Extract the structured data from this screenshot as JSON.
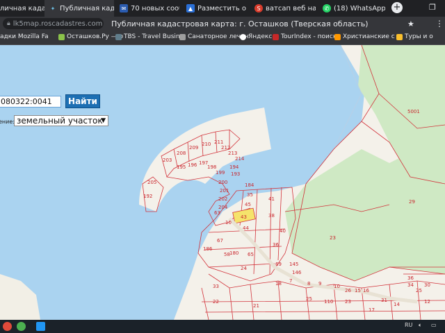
{
  "tabs": [
    {
      "label": "личная кадаст",
      "active": false
    },
    {
      "label": "Публичная када",
      "active": true
    },
    {
      "label": "70 новых сообщен",
      "active": false
    },
    {
      "label": "Разместить объяв",
      "active": false
    },
    {
      "label": "ватсап веб на ком",
      "active": false
    },
    {
      "label": "(18) WhatsApp",
      "active": false
    }
  ],
  "address": {
    "url": "lk5map.roscadastres.com",
    "page_title": "Публичная кадастровая карта: г. Осташков (Тверская область)"
  },
  "bookmarks": [
    "адки Mozilla Fa",
    "Осташков.Ру — о",
    "TBS - Travel Busin",
    "Санаторное лечен",
    "Яндекс",
    "TourIndex - поиск",
    "Христианские с д",
    "Туры и о"
  ],
  "search": {
    "value": "080322:0041",
    "button_label": "Найти"
  },
  "object_type": {
    "label": "ение:",
    "selected": "земельный участок"
  },
  "map_labels": {
    "top_row": [
      "203",
      "208",
      "209",
      "210",
      "211",
      "212",
      "213"
    ],
    "arc": [
      "192",
      "205",
      "195",
      "196",
      "197",
      "198",
      "199",
      "200",
      "201",
      "202",
      "204",
      "214",
      "194",
      "193"
    ],
    "mid": [
      "184",
      "35",
      "45",
      "43",
      "63",
      "10",
      "44",
      "41",
      "38",
      "40",
      "36",
      "5001",
      "29",
      "23"
    ],
    "lower": [
      "186",
      "67",
      "58",
      "180",
      "65",
      "69",
      "145",
      "146",
      "18",
      "7",
      "9",
      "10",
      "8",
      "24",
      "26",
      "15",
      "16",
      "22",
      "25",
      "110",
      "23",
      "21",
      "25",
      "36",
      "34",
      "30",
      "14",
      "12",
      "17",
      "33",
      "31"
    ]
  },
  "taskbar": {
    "lang": "RU",
    "icons": [
      "windows-start",
      "chrome",
      "edge"
    ]
  }
}
